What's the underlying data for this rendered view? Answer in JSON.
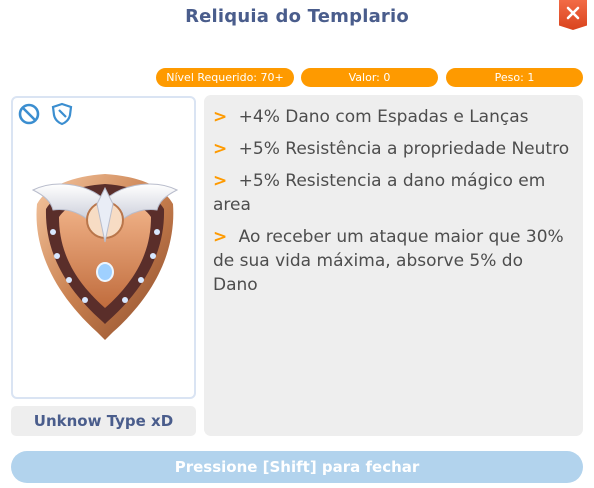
{
  "window": {
    "title": "Reliquia do Templario",
    "close_icon": "close-x-icon"
  },
  "stats": {
    "level_required": "Nível Requerido: 70+",
    "value": "Valor: 0",
    "weight": "Peso: 1"
  },
  "item": {
    "type_label": "Unknow Type xD",
    "badges": [
      "no-icon",
      "shield-icon"
    ],
    "image": "templar-shield-icon"
  },
  "description": {
    "bullet": ">",
    "lines": [
      "+4% Dano com Espadas e Lanças",
      "+5% Resistência a propriedade Neutro",
      "+5% Resistencia a dano mágico em area",
      "Ao receber um ataque maior que 30% de sua vida máxima, absorve 5% do Dano"
    ]
  },
  "footer": {
    "close_hint": "Pressione [Shift] para fechar"
  },
  "colors": {
    "accent_orange": "#fe9a00",
    "title_blue": "#4a5d8c",
    "close_red": "#e2512a",
    "footer_button": "#b2d3ed",
    "panel_gray": "#eeeeee"
  }
}
